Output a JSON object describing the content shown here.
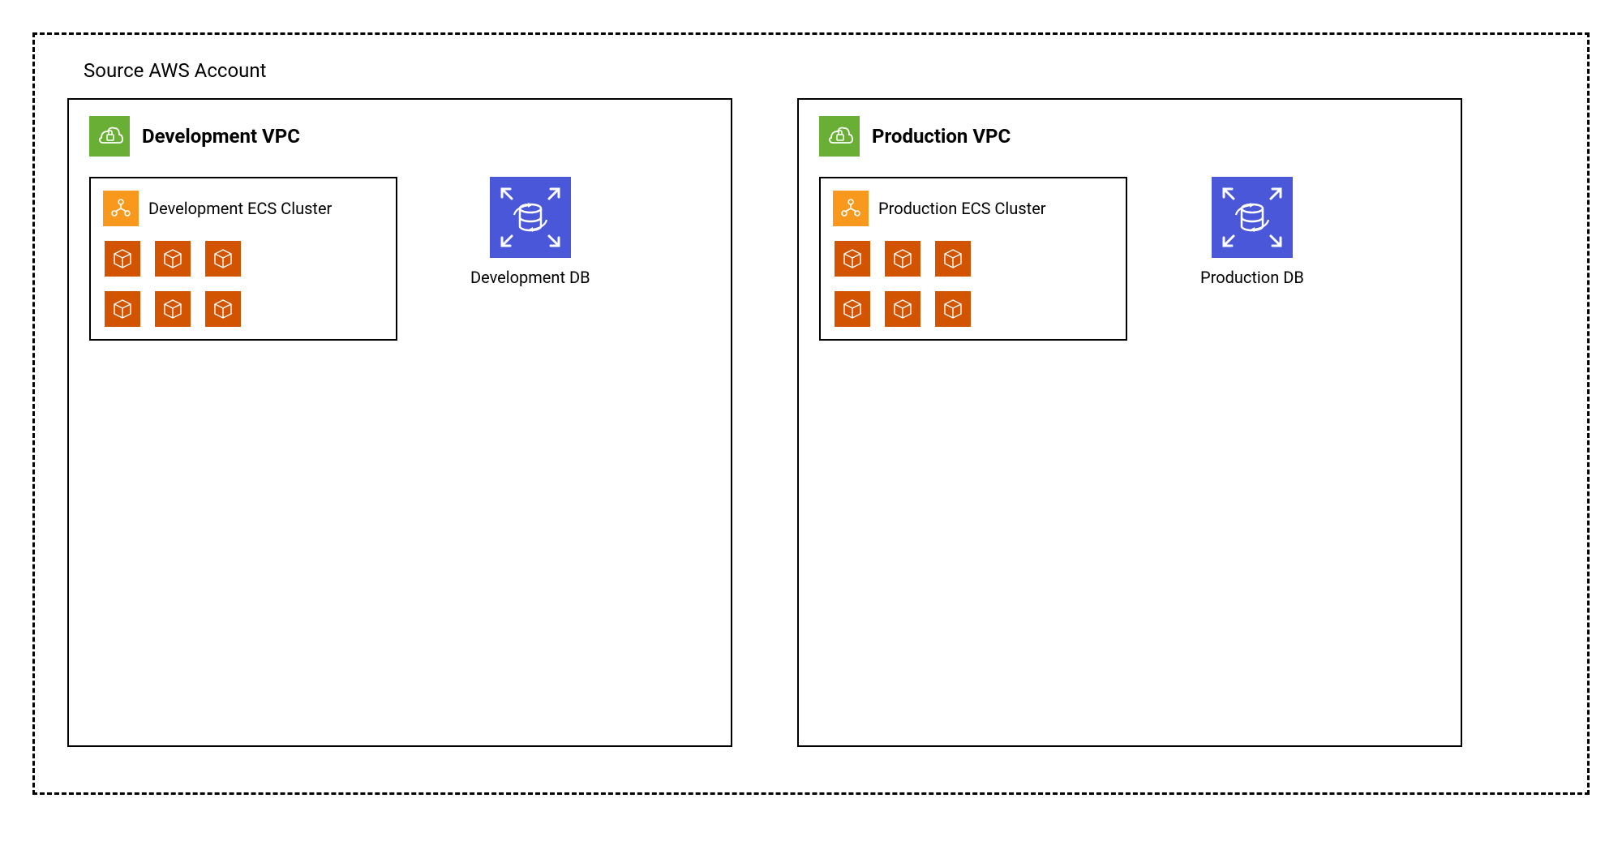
{
  "account": {
    "title": "Source AWS Account"
  },
  "vpcs": [
    {
      "title": "Development VPC",
      "ecs": {
        "title": "Development ECS Cluster",
        "container_count": 6
      },
      "db": {
        "label": "Development DB"
      }
    },
    {
      "title": "Production VPC",
      "ecs": {
        "title": "Production ECS Cluster",
        "container_count": 6
      },
      "db": {
        "label": "Production DB"
      }
    }
  ],
  "colors": {
    "vpc_icon_bg": "#6aaf35",
    "ecs_icon_bg": "#f8991d",
    "container_bg": "#d35400",
    "db_bg": "#4957d8"
  }
}
